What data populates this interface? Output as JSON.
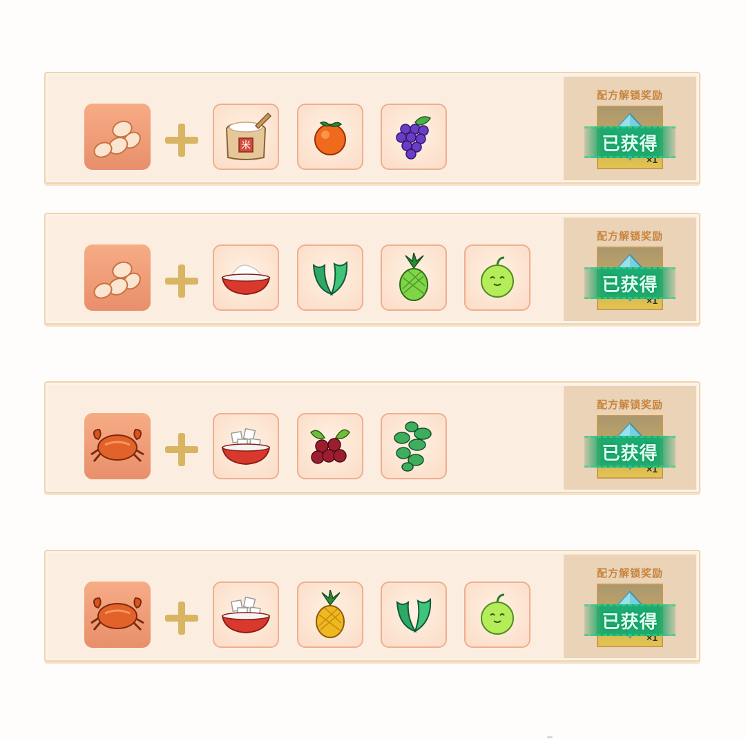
{
  "reward_title": "配方解锁奖励",
  "reward_status": "已获得",
  "reward_count": "×1",
  "recipes": [
    {
      "main": "eggs-icon",
      "ingredients": [
        "flour-sack-icon",
        "orange-icon",
        "grape-icon"
      ]
    },
    {
      "main": "eggs-icon",
      "ingredients": [
        "salt-bowl-icon",
        "aloe-leaf-icon",
        "green-pineapple-icon",
        "melon-icon"
      ]
    },
    {
      "main": "crab-icon",
      "ingredients": [
        "sugar-cube-bowl-icon",
        "berry-cluster-icon",
        "green-grape-vine-icon"
      ]
    },
    {
      "main": "crab-icon",
      "ingredients": [
        "sugar-cube-bowl-icon",
        "pineapple-icon",
        "aloe-leaf-icon",
        "melon-icon"
      ]
    }
  ]
}
